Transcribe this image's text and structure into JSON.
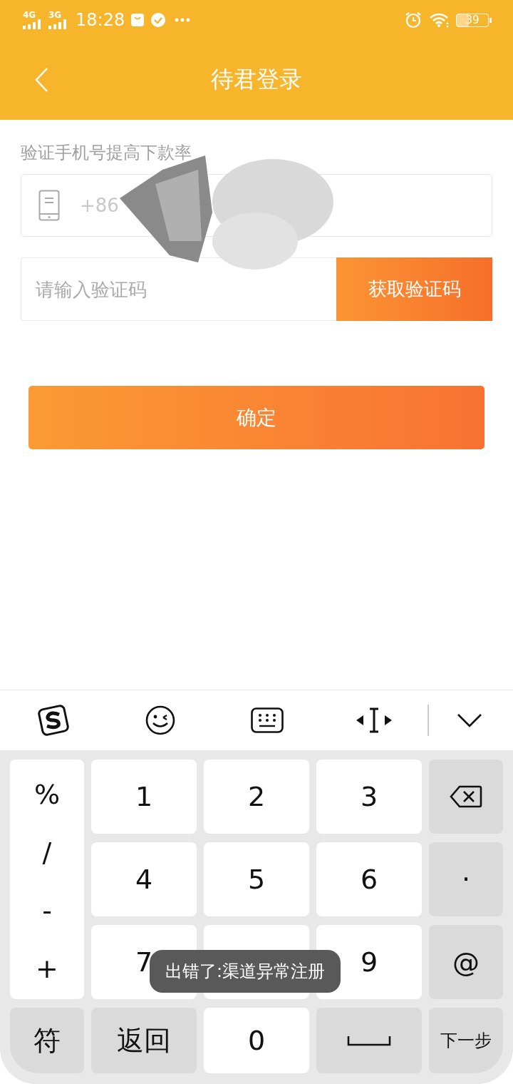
{
  "status_bar": {
    "network_1": "4G",
    "network_2": "3G",
    "time": "18:28",
    "battery": "39"
  },
  "header": {
    "title": "待君登录"
  },
  "form": {
    "hint": "验证手机号提高下款率",
    "phone_field": {
      "prefix": "+86"
    },
    "code_field": {
      "placeholder": "请输入验证码"
    },
    "get_code_button": "获取验证码",
    "confirm_button": "确定"
  },
  "keyboard": {
    "symbol_keys": [
      "%",
      "/",
      "-",
      "+"
    ],
    "rows": [
      [
        {
          "kind": "digit",
          "label": "1"
        },
        {
          "kind": "digit",
          "label": "2"
        },
        {
          "kind": "digit",
          "label": "3"
        },
        {
          "kind": "backspace"
        }
      ],
      [
        {
          "kind": "digit",
          "label": "4"
        },
        {
          "kind": "digit",
          "label": "5"
        },
        {
          "kind": "digit",
          "label": "6"
        },
        {
          "kind": "function",
          "label": "·"
        }
      ],
      [
        {
          "kind": "digit",
          "label": "7"
        },
        {
          "kind": "digit"
        },
        {
          "kind": "digit",
          "label": "9"
        },
        {
          "kind": "function",
          "label": "@"
        }
      ]
    ],
    "bottom_row": [
      {
        "kind": "function",
        "label": "符"
      },
      {
        "kind": "function",
        "label": "返回"
      },
      {
        "kind": "digit",
        "label": "0"
      },
      {
        "kind": "space"
      },
      {
        "kind": "small",
        "label": "下一步"
      }
    ]
  },
  "toast": {
    "text": "出错了:渠道异常注册"
  }
}
